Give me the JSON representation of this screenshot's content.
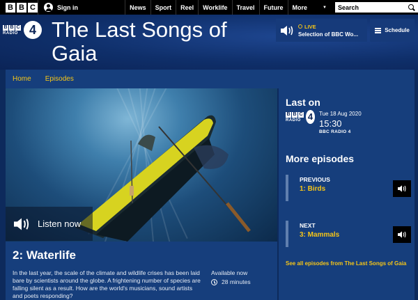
{
  "global_nav": {
    "bbc_letters": [
      "B",
      "B",
      "C"
    ],
    "sign_in": "Sign in",
    "items": [
      "News",
      "Sport",
      "Reel",
      "Worklife",
      "Travel",
      "Future",
      "More"
    ],
    "search_placeholder": "Search"
  },
  "station": {
    "logo_letters": [
      "B",
      "B",
      "C"
    ],
    "logo_word": "RADIO",
    "logo_number": "4"
  },
  "programme": {
    "title": "The Last Songs of Gaia"
  },
  "live": {
    "label": "LIVE",
    "title": "Selection of BBC Wo..."
  },
  "schedule": {
    "label": "Schedule"
  },
  "prog_nav": [
    "Home",
    "Episodes"
  ],
  "hero": {
    "listen_label": "Listen now"
  },
  "episode": {
    "title": "2: Waterlife",
    "description": "In the last year, the scale of the climate and wildlife crises has been laid bare by scientists around the globe. A frightening number of species are falling silent as a result. How are the world's musicians, sound artists and poets responding?",
    "availability": "Available now",
    "duration": "28 minutes"
  },
  "sidebar": {
    "last_on_heading": "Last on",
    "last_on": {
      "date": "Tue 18 Aug 2020",
      "time": "15:30",
      "station": "BBC RADIO 4"
    },
    "more_heading": "More episodes",
    "previous": {
      "label": "PREVIOUS",
      "title": "1: Birds"
    },
    "next": {
      "label": "NEXT",
      "title": "3: Mammals"
    },
    "see_all": "See all episodes from The Last Songs of Gaia"
  },
  "colors": {
    "accent": "#f5c518",
    "background": "#0d2a5c",
    "panel": "#163e7c",
    "topbar": "#000000"
  },
  "icons": [
    "user-icon",
    "search-icon",
    "speaker-icon",
    "schedule-icon",
    "clock-icon",
    "chevron-down-icon"
  ]
}
